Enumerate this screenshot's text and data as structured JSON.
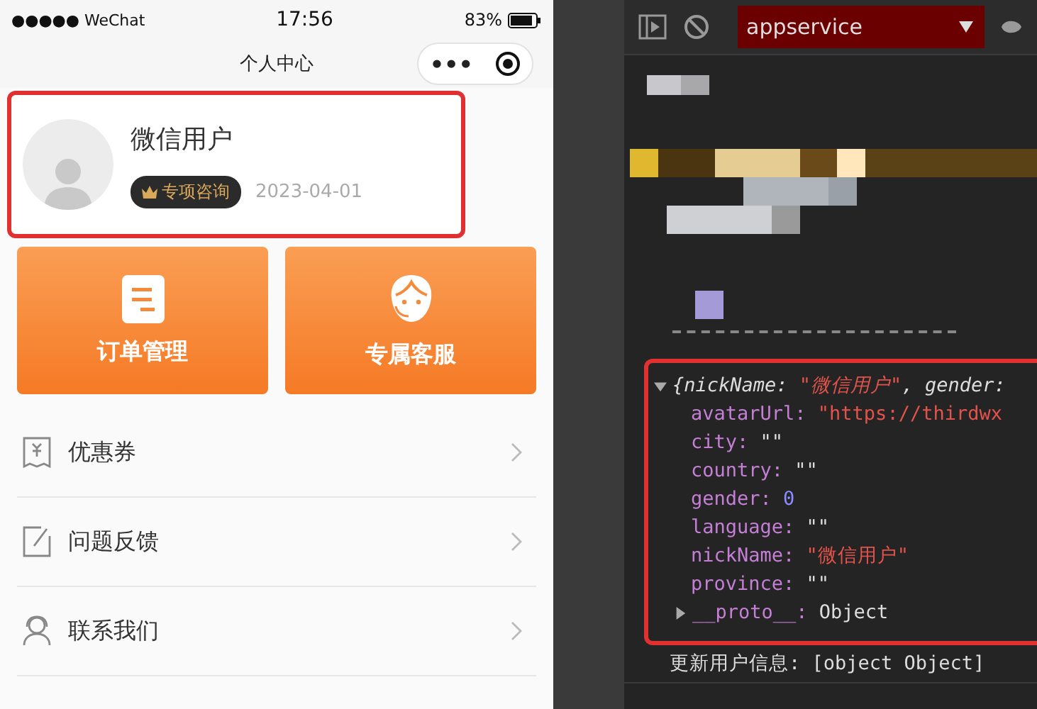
{
  "status_bar": {
    "signal": "●●●●●",
    "carrier": "WeChat",
    "time": "17:56",
    "battery": "83%"
  },
  "nav": {
    "title": "个人中心",
    "menu": "•••"
  },
  "profile": {
    "name": "微信用户",
    "badge": "专项咨询",
    "date": "2023-04-01"
  },
  "tiles": [
    {
      "kind": "order",
      "label": "订单管理"
    },
    {
      "kind": "service",
      "label": "专属客服"
    }
  ],
  "menu_items": [
    {
      "kind": "coupon",
      "label": "优惠券"
    },
    {
      "kind": "feedback",
      "label": "问题反馈"
    },
    {
      "kind": "contact",
      "label": "联系我们"
    }
  ],
  "devtools": {
    "context": "appservice",
    "log_object": {
      "expanded": true,
      "summary_key": "{nickName:",
      "summary_value": "\"微信用户\"",
      "summary_tail": ", gender:",
      "properties": [
        {
          "key": "avatarUrl:",
          "value": "\"https://thirdwx",
          "kind": "string"
        },
        {
          "key": "city:",
          "value": "\"\"",
          "kind": "empty"
        },
        {
          "key": "country:",
          "value": "\"\"",
          "kind": "empty"
        },
        {
          "key": "gender:",
          "value": "0",
          "kind": "number"
        },
        {
          "key": "language:",
          "value": "\"\"",
          "kind": "empty"
        },
        {
          "key": "nickName:",
          "value": "\"微信用户\"",
          "kind": "string"
        },
        {
          "key": "province:",
          "value": "\"\"",
          "kind": "empty"
        }
      ],
      "proto": {
        "key": "__proto__:",
        "value": "Object",
        "expanded": false
      }
    },
    "log_message": "更新用户信息: [object Object]"
  }
}
